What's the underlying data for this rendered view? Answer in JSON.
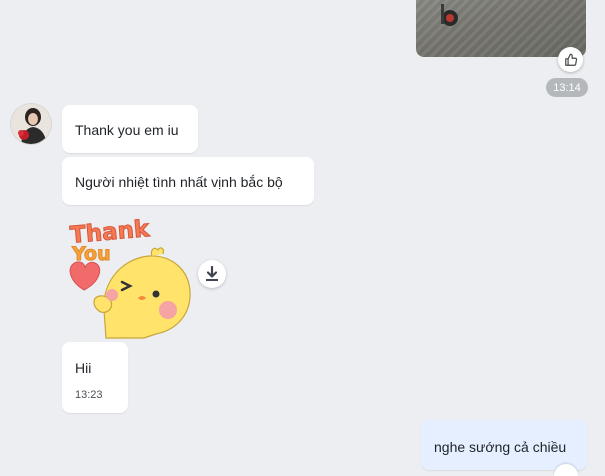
{
  "conversation": {
    "sent_image": {
      "time": "13:14",
      "like_icon": "thumbs-up-icon"
    },
    "received": {
      "messages": [
        {
          "text": "Thank you em iu"
        },
        {
          "text": "Người nhiệt tình nhất vịnh bắc bộ"
        }
      ],
      "sticker": {
        "text_line1": "Thank",
        "text_line2": "You",
        "download_icon": "download-icon"
      },
      "last_message": {
        "text": "Hii",
        "time": "13:23"
      }
    },
    "sent": {
      "text": "nghe sướng cả chiều"
    }
  },
  "colors": {
    "background": "#eceef2",
    "received_bubble": "#ffffff",
    "sent_bubble": "#e5efff",
    "time_pill": "#b4b8bd"
  }
}
